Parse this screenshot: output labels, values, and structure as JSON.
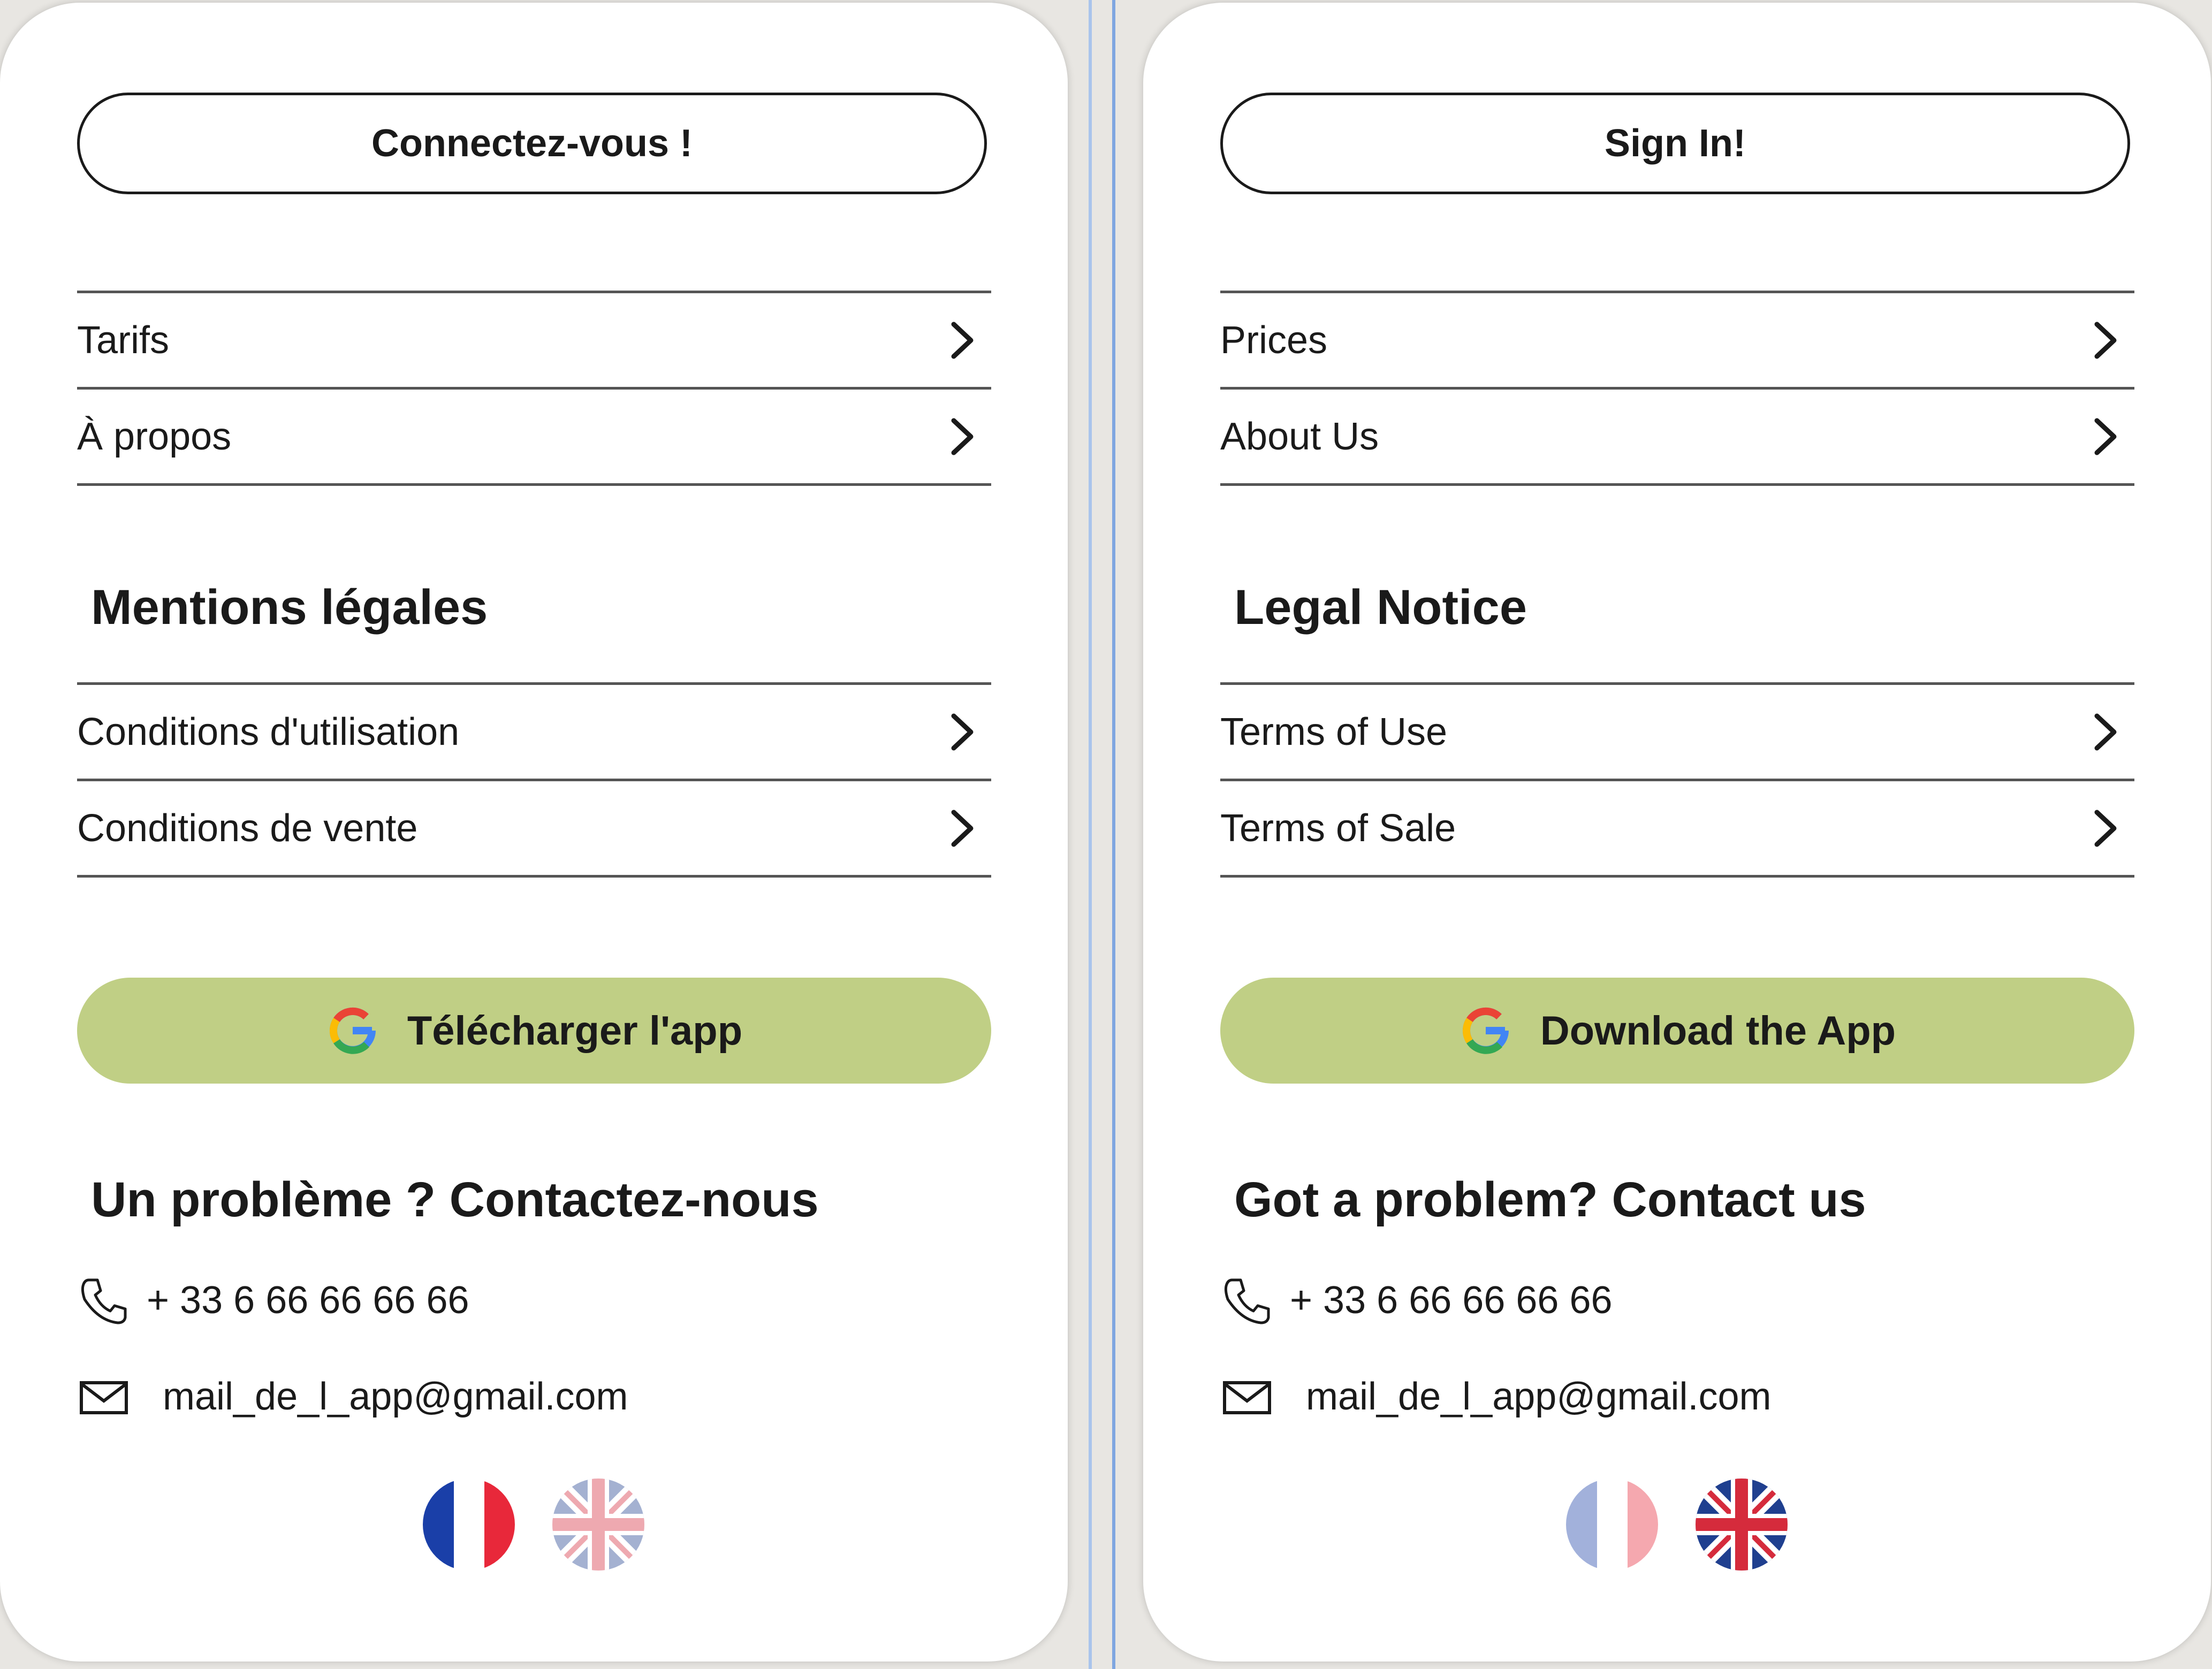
{
  "panels": {
    "fr": {
      "signin_label": "Connectez-vous !",
      "menu_top": [
        "Tarifs",
        "À propos"
      ],
      "legal_title": "Mentions légales",
      "menu_legal": [
        "Conditions d'utilisation",
        "Conditions de vente"
      ],
      "download_label": "Télécharger l'app",
      "contact_title": "Un problème ? Contactez-nous",
      "phone": "+ 33 6 66 66 66 66",
      "email": "mail_de_l_app@gmail.com",
      "active_language": "fr"
    },
    "en": {
      "signin_label": "Sign In!",
      "menu_top": [
        "Prices",
        "About Us"
      ],
      "legal_title": "Legal Notice",
      "menu_legal": [
        "Terms of Use",
        "Terms of Sale"
      ],
      "download_label": "Download the App",
      "contact_title": "Got a problem? Contact us",
      "phone": "+ 33 6 66 66 66 66",
      "email": "mail_de_l_app@gmail.com",
      "active_language": "en"
    }
  },
  "icons": {
    "menu_arrow": "chevron-right-icon",
    "download": "google-icon",
    "phone": "phone-icon",
    "email": "mail-icon",
    "language_fr": "french-flag-icon",
    "language_en": "uk-flag-icon"
  },
  "colors": {
    "download_button": "#c0cf85",
    "divider": "#a9c4ec",
    "background": "#e8e6e2"
  }
}
